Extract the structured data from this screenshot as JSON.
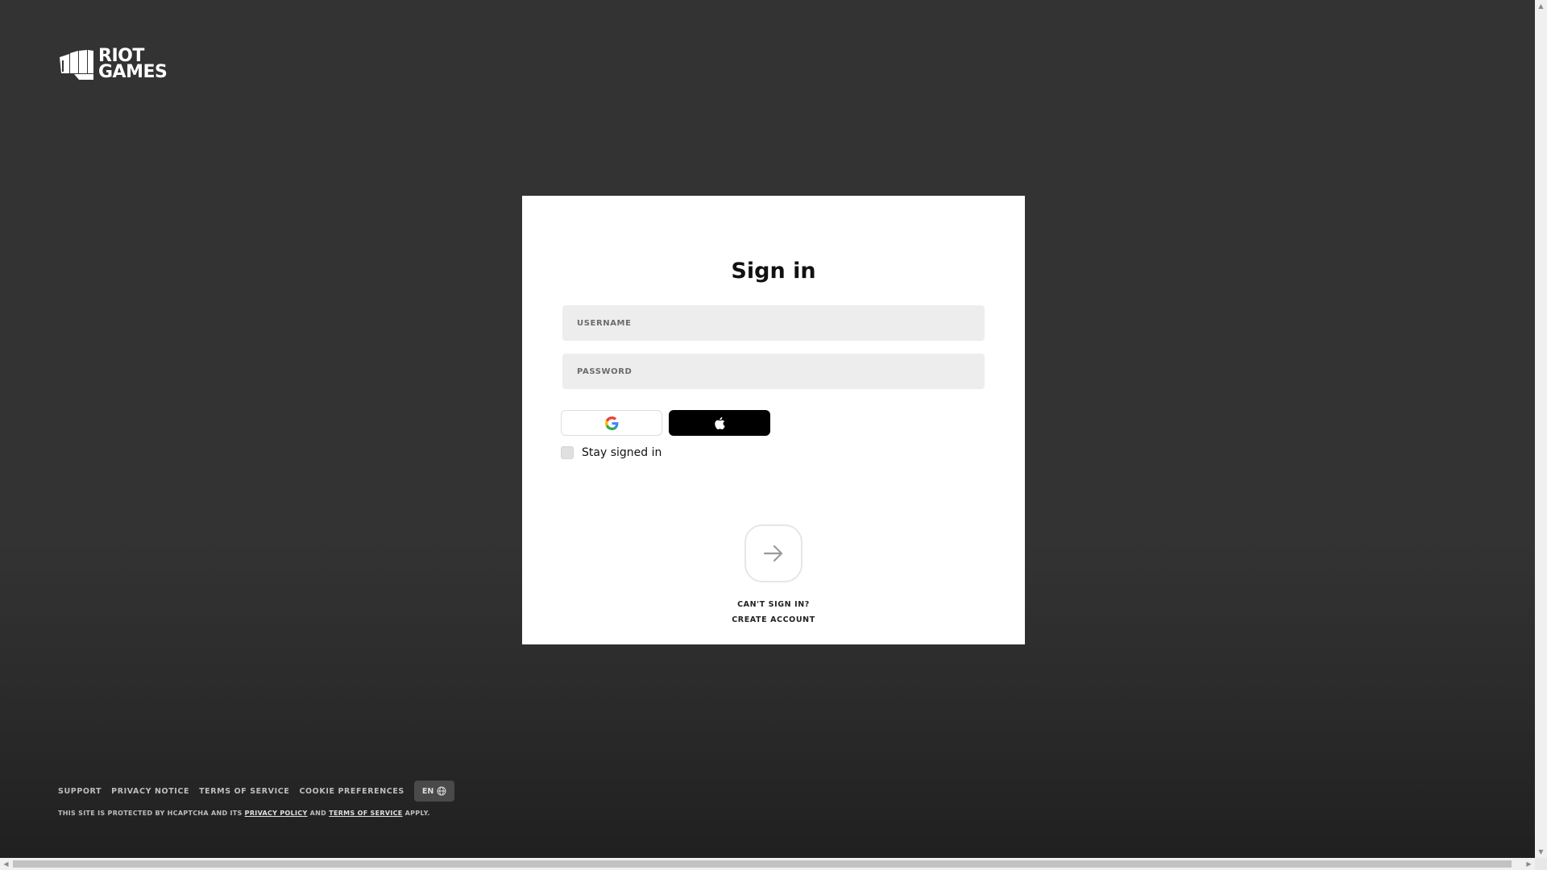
{
  "brand": {
    "logo_line1": "RIOT",
    "logo_line2": "GAMES"
  },
  "signin": {
    "title": "Sign in",
    "username_placeholder": "USERNAME",
    "password_placeholder": "PASSWORD",
    "stay_signed_in_label": "Stay signed in",
    "stay_signed_in_checked": false,
    "cant_sign_in": "CAN'T SIGN IN?",
    "create_account": "CREATE ACCOUNT",
    "social_buttons": [
      {
        "icon": "google-icon"
      },
      {
        "icon": "apple-icon"
      }
    ],
    "submit_icon": "arrow-right-icon"
  },
  "footer": {
    "links": [
      "SUPPORT",
      "PRIVACY NOTICE",
      "TERMS OF SERVICE",
      "COOKIE PREFERENCES"
    ],
    "language": "EN",
    "language_icon": "globe-icon",
    "captcha_prefix": "THIS SITE IS PROTECTED BY HCAPTCHA AND ITS",
    "privacy_policy": "PRIVACY POLICY",
    "and": "AND",
    "terms_of_service": "TERMS OF SERVICE",
    "apply": "APPLY."
  },
  "colors": {
    "background": "#333333",
    "card": "#ffffff",
    "field": "#ededed",
    "apple_button": "#000000"
  }
}
